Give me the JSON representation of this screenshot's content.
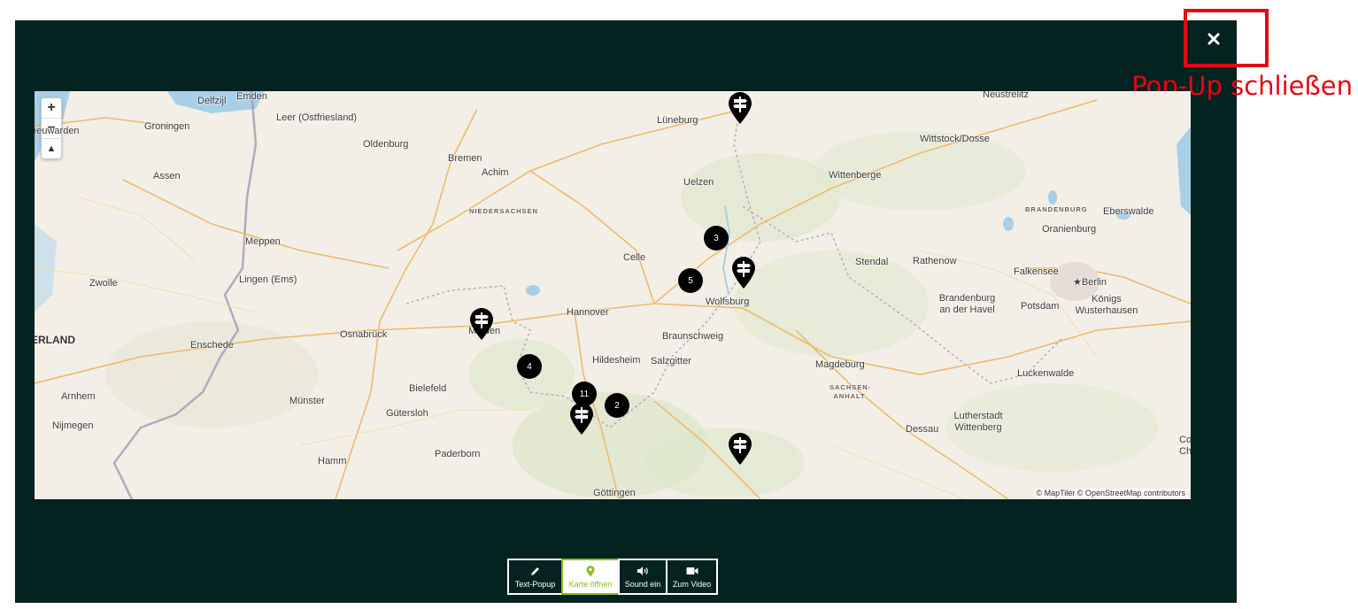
{
  "popup": {
    "close_icon": "close-icon",
    "annotation_label": "Pop-Up schließen",
    "annotation_color": "#e30613",
    "background_color": "#032220"
  },
  "map": {
    "zoom_in_label": "+",
    "zoom_out_label": "−",
    "reset_north_label": "▲",
    "attribution": "© MapTiler © OpenStreetMap contributors",
    "places": [
      "Emden",
      "Delfzijl",
      "Leer (Ostfriesland)",
      "Groningen",
      "Leeuwarden",
      "Assen",
      "Oldenburg",
      "Bremen",
      "Achim",
      "Lüneburg",
      "Neustrelitz",
      "Wittstock/Dosse",
      "Wittenberge",
      "Uelzen",
      "NIEDERSACHSEN",
      "BRANDENBURG",
      "Eberswalde",
      "Oranienburg",
      "Meppen",
      "Celle",
      "Stendal",
      "Rathenow",
      "Falkensee",
      "Berlin",
      "Zwolle",
      "Lingen (Ems)",
      "Wolfsburg",
      "Brandenburg an der Havel",
      "Potsdam",
      "Königs Wusterhausen",
      "NEDERLAND",
      "Hannover",
      "Minden",
      "Enschede",
      "Osnabrück",
      "Braunschweig",
      "Hildesheim",
      "Salzgitter",
      "Magdeburg",
      "Luckenwalde",
      "Arnhem",
      "Bielefeld",
      "SACHSEN-ANHALT",
      "Münster",
      "Gütersloh",
      "Nijmegen",
      "Dessau",
      "Lutherstadt Wittenberg",
      "Paderborn",
      "Hamm",
      "Göttingen",
      "Co",
      "Ch"
    ],
    "clusters": [
      "3",
      "5",
      "4",
      "11",
      "2"
    ],
    "marker_icon": "signpost-pin-icon",
    "country_label": "ERLAND",
    "region_labels": [
      "NIEDERSACHSEN",
      "BRANDENBURG",
      "SACHSEN-ANHALT"
    ]
  },
  "toolbar": {
    "buttons": [
      {
        "label": "Text-Popup",
        "icon": "pencil-icon"
      },
      {
        "label": "Karte öffnen",
        "icon": "map-pin-icon",
        "active": true
      },
      {
        "label": "Sound ein",
        "icon": "speaker-icon"
      },
      {
        "label": "Zum Video",
        "icon": "video-camera-icon"
      }
    ],
    "active_color": "#8dbb21"
  }
}
